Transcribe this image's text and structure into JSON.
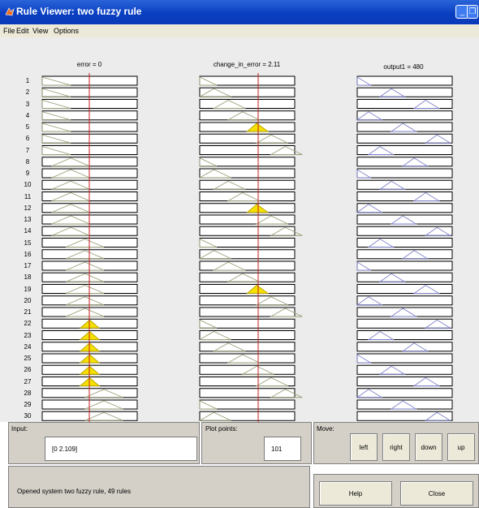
{
  "window": {
    "title": "Rule Viewer: two fuzzy rule"
  },
  "menu": [
    "File",
    "Edit",
    "View",
    "Options"
  ],
  "columns": [
    {
      "header": "error = 0"
    },
    {
      "header": "change_in_error = 2.11"
    },
    {
      "header": "output1 = 480"
    }
  ],
  "rows": [
    "1",
    "2",
    "3",
    "4",
    "5",
    "6",
    "7",
    "8",
    "9",
    "10",
    "11",
    "12",
    "13",
    "14",
    "15",
    "16",
    "17",
    "18",
    "19",
    "20",
    "21",
    "22",
    "23",
    "24",
    "25",
    "26",
    "27",
    "28",
    "29",
    "30"
  ],
  "fired_rows": {
    "error": [
      22,
      23,
      24,
      25,
      26,
      27
    ],
    "change_in_error": [
      5,
      12,
      19
    ]
  },
  "colors": {
    "mf_line": "#9aa07a",
    "output_line": "#7d80c8",
    "fired": "#f5e000",
    "cursor": "#c81e1e",
    "panel": "#d4d0c8"
  },
  "controls": {
    "input_label": "Input:",
    "input_value": "[0 2.109]",
    "plot_points_label": "Plot points:",
    "plot_points_value": "101",
    "move_label": "Move:",
    "left": "left",
    "right": "right",
    "down": "down",
    "up": "up",
    "status": "Opened system two fuzzy rule, 49 rules",
    "help": "Help",
    "close": "Close"
  }
}
